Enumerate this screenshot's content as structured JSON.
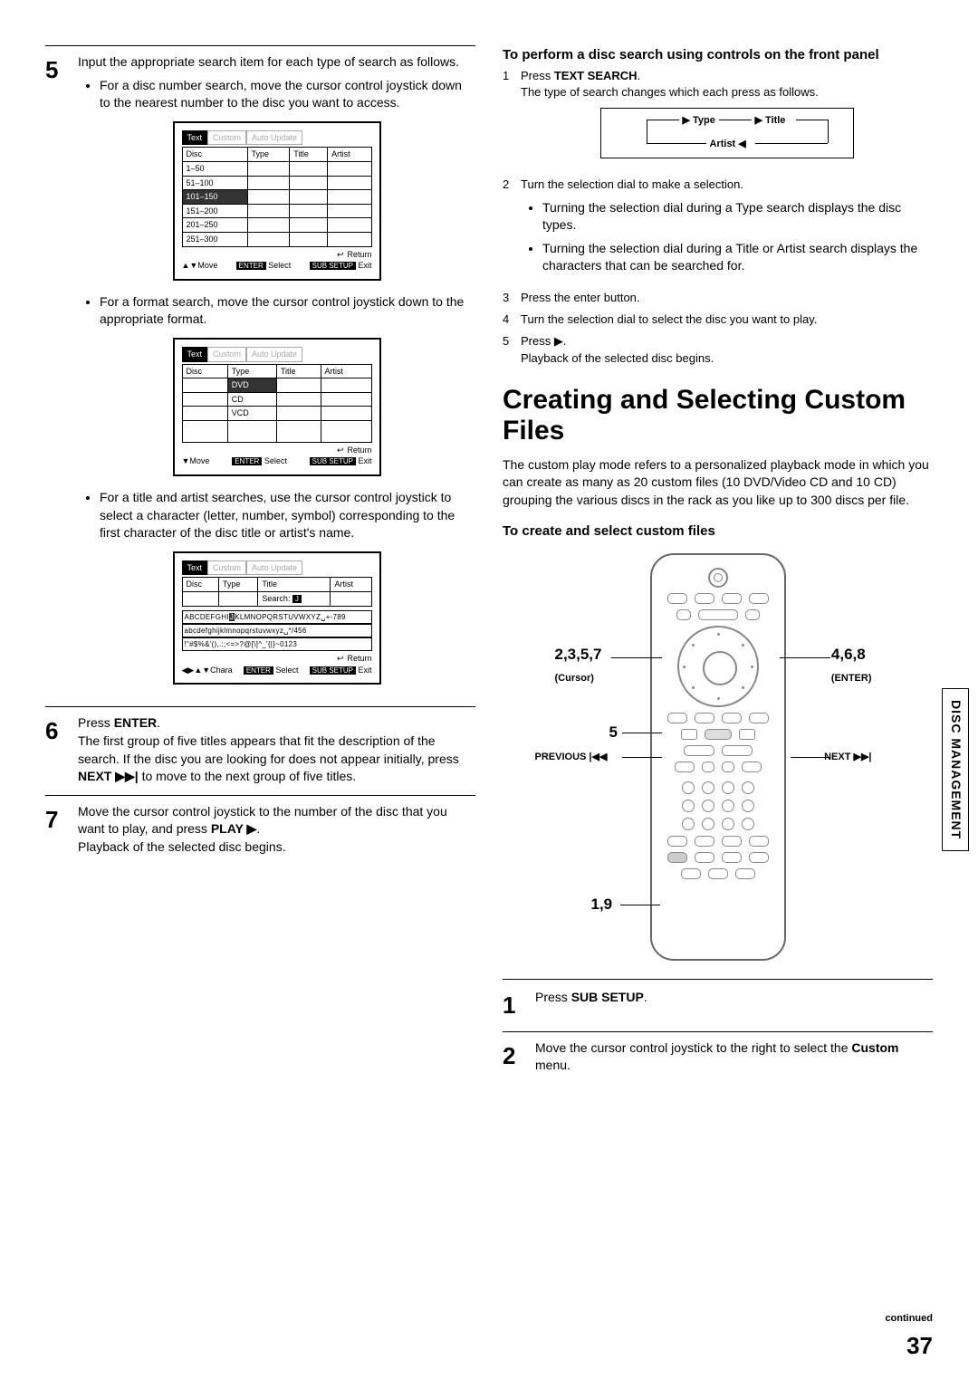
{
  "left": {
    "step5": {
      "num": "5",
      "intro": "Input the appropriate search item for each type of search as follows.",
      "bullet1": "For a disc number search, move the cursor control joystick down to the nearest number to the disc you want to access.",
      "osd1": {
        "tabs": [
          "Text",
          "Custom",
          "Auto Update"
        ],
        "headers": [
          "Disc",
          "Type",
          "Title",
          "Artist"
        ],
        "rows": [
          "1–50",
          "51–100",
          "101–150",
          "151–200",
          "201–250",
          "251–300"
        ],
        "selected": "101–150",
        "return": "Return",
        "foot_left": "Move",
        "foot_enter": "ENTER",
        "foot_select": "Select",
        "foot_sub": "SUB SETUP",
        "foot_exit": "Exit"
      },
      "bullet2": "For a format search, move the cursor control joystick down to the appropriate format.",
      "osd2": {
        "rows": [
          "DVD",
          "CD",
          "VCD"
        ],
        "selected": "DVD"
      },
      "bullet3": "For a title and artist searches, use the cursor control joystick to select a character (letter, number, symbol) corresponding to the first character of the disc title or artist's name.",
      "osd3": {
        "search_label": "Search:",
        "search_val": "J",
        "row1a": "ABCDEFGHI",
        "row1b": "J",
        "row1c": "KLMNOPQRSTUVWXYZ␣+-789",
        "row2": "abcdefghijklmnopqrstuvwxyz␣*/456",
        "row3": "!\"#$%&'(),.:;<=>?@[\\]^_'{|}~0123",
        "foot_left": "Chara"
      }
    },
    "step6": {
      "num": "6",
      "line1a": "Press ",
      "line1b": "ENTER",
      "line1c": ".",
      "body_a": "The first group of five titles appears that fit the description of the search. If the disc you are looking for does not appear initially, press ",
      "body_b": "NEXT ▶▶|",
      "body_c": " to move to the next group of five titles."
    },
    "step7": {
      "num": "7",
      "line_a": "Move the cursor control joystick to the number of the disc that you want to play, and press ",
      "line_b": "PLAY ▶",
      "line_c": ".",
      "sub": "Playback of the selected disc begins."
    }
  },
  "right": {
    "front_panel": {
      "heading": "To perform a disc search using controls on the front panel",
      "s1a": "Press ",
      "s1b": "TEXT SEARCH",
      "s1c": ".",
      "s1_body": "The type of search changes which each press as follows.",
      "flow": {
        "type": "Type",
        "title": "Title",
        "artist": "Artist"
      },
      "s2": "Turn the selection dial to make a selection.",
      "s2_b1": "Turning the selection dial during a Type search displays the disc types.",
      "s2_b2": "Turning the selection dial during a Title or Artist search displays the characters that can be searched for.",
      "s3": "Press the enter button.",
      "s4": "Turn the selection dial to select the disc you want to play.",
      "s5": "Press ▶.",
      "s5_body": "Playback of the selected disc begins."
    },
    "custom": {
      "heading": "Creating and Selecting Custom Files",
      "para": "The custom play mode refers to a personalized playback mode in which you can create as many as 20 custom files (10 DVD/Video CD and 10 CD) grouping the various discs in the rack as you like up to 300 discs per file.",
      "subheading": "To create and select custom files",
      "labels": {
        "l1": "2,3,5,7",
        "l1_sub": "(Cursor)",
        "l2": "4,6,8",
        "l2_sub": "(ENTER)",
        "l3": "5",
        "l4": "PREVIOUS |◀◀",
        "l5": "NEXT ▶▶|",
        "l6": "1,9"
      },
      "step1_num": "1",
      "step1_a": "Press ",
      "step1_b": "SUB SETUP",
      "step1_c": ".",
      "step2_num": "2",
      "step2_a": "Move the cursor control joystick to the right to select the ",
      "step2_b": "Custom",
      "step2_c": " menu."
    }
  },
  "side_tab": "DISC MANAGEMENT",
  "continued": "continued",
  "page": "37"
}
